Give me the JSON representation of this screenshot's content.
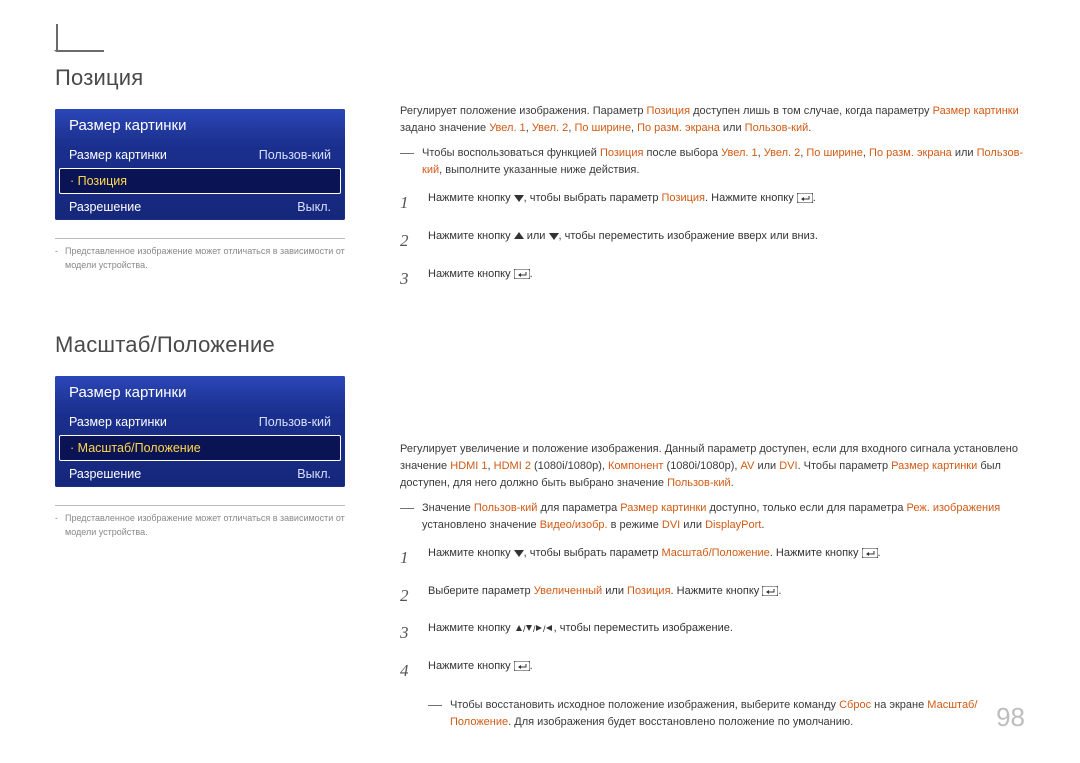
{
  "page_number": "98",
  "section1": {
    "title": "Позиция",
    "osd": {
      "title": "Размер картинки",
      "row1": {
        "label": "Размер картинки",
        "value": "Пользов-кий"
      },
      "row2": {
        "label": "· Позиция",
        "value": ""
      },
      "row3": {
        "label": "Разрешение",
        "value": "Выкл."
      }
    },
    "footnote": "Представленное изображение может отличаться в зависимости от модели устройства.",
    "intro_a": "Регулирует положение изображения. Параметр ",
    "intro_b": " доступен лишь в том случае, когда параметру ",
    "intro_c": " задано значение ",
    "intro_sep1": ", ",
    "intro_sep2": ", ",
    "intro_sep3": ", ",
    "intro_or": " или ",
    "intro_end": ".",
    "hl_position": "Позиция",
    "hl_size": "Размер картинки",
    "hl_z1": "Увел. 1",
    "hl_z2": "Увел. 2",
    "hl_wide": "По ширине",
    "hl_screen": "По разм. экрана",
    "hl_custom": "Пользов-кий",
    "dash_a": "Чтобы воспользоваться функцией ",
    "dash_b": " после выбора ",
    "dash_c": " или ",
    "dash_d": ", выполните указанные ниже действия.",
    "step1_a": "Нажмите кнопку ",
    "step1_b": ", чтобы выбрать параметр ",
    "step1_c": ". Нажмите кнопку ",
    "step1_d": ".",
    "step2_a": "Нажмите кнопку ",
    "step2_b": " или ",
    "step2_c": ", чтобы переместить изображение вверх или вниз.",
    "step3_a": "Нажмите кнопку ",
    "step3_b": "."
  },
  "section2": {
    "title": "Масштаб/Положение",
    "osd": {
      "title": "Размер картинки",
      "row1": {
        "label": "Размер картинки",
        "value": "Пользов-кий"
      },
      "row2": {
        "label": "· Масштаб/Положение",
        "value": ""
      },
      "row3": {
        "label": "Разрешение",
        "value": "Выкл."
      }
    },
    "footnote": "Представленное изображение может отличаться в зависимости от модели устройства.",
    "p1_a": "Регулирует увеличение и положение изображения. Данный параметр доступен, если для входного сигнала установлено значение ",
    "p1_b": " (1080i/1080p), ",
    "p1_c": " (1080i/1080p), ",
    "p1_d": " или ",
    "p1_e": ". Чтобы параметр ",
    "p1_f": " был доступен, для него должно быть выбрано значение ",
    "p1_g": ".",
    "hl_hdmi1": "HDMI 1",
    "hl_hdmi2": "HDMI 2",
    "hl_sep": ", ",
    "hl_component": "Компонент",
    "hl_av": "AV",
    "hl_dvi": "DVI",
    "hl_size": "Размер картинки",
    "hl_custom": "Пользов-кий",
    "dash_a": "Значение ",
    "dash_b": " для параметра ",
    "dash_c": " доступно, только если для параметра ",
    "dash_d": " установлено значение ",
    "dash_e": " в режиме ",
    "dash_f": " или ",
    "dash_g": ".",
    "hl_imgmode": "Реж. изображения",
    "hl_videoimg": "Видео/изобр.",
    "hl_dvi2": "DVI",
    "hl_dp": "DisplayPort",
    "hl_zoompos": "Масштаб/Положение",
    "hl_enlarged": "Увеличенный",
    "hl_position": "Позиция",
    "step1_a": "Нажмите кнопку ",
    "step1_b": ", чтобы выбрать параметр ",
    "step1_c": ". Нажмите кнопку ",
    "step1_d": ".",
    "step2_a": "Выберите параметр ",
    "step2_or": " или ",
    "step2_b": ". Нажмите кнопку ",
    "step2_c": ".",
    "step3_a": "Нажмите кнопку ",
    "step3_b": ", чтобы переместить изображение.",
    "step4_a": "Нажмите кнопку ",
    "step4_b": ".",
    "dash2_a": "Чтобы восстановить исходное положение изображения, выберите команду ",
    "dash2_b": " на экране ",
    "dash2_c": ". Для изображения будет восстановлено положение по умолчанию.",
    "hl_reset": "Сброс"
  }
}
